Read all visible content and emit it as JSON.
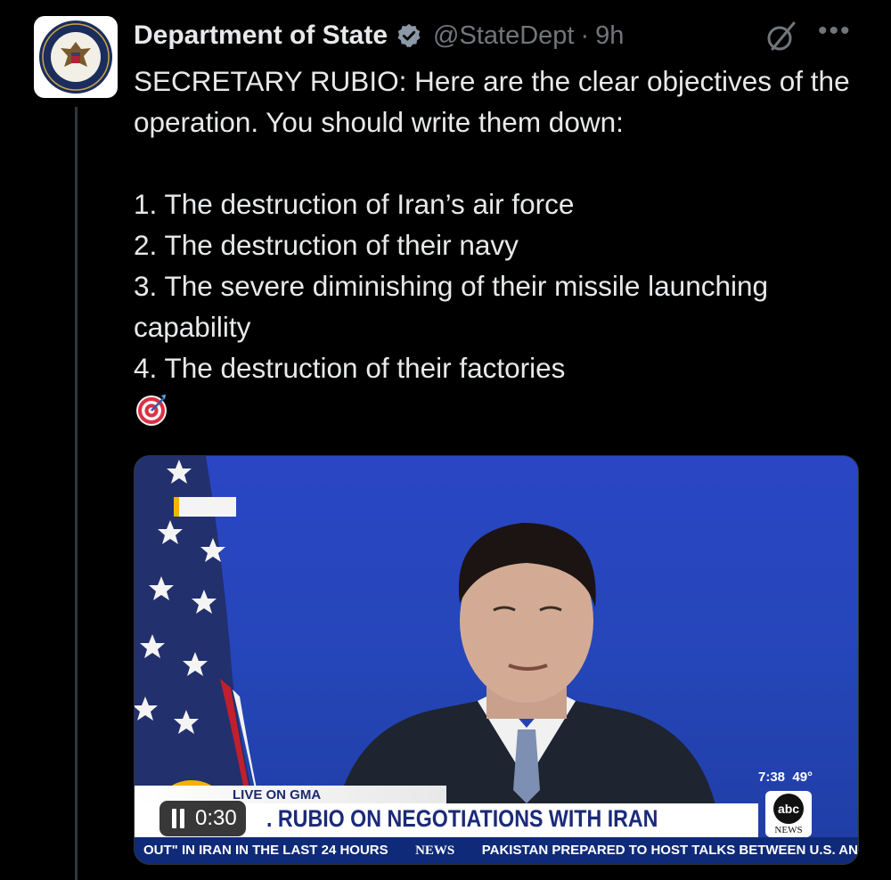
{
  "post": {
    "author_name": "Department of State",
    "handle": "@StateDept",
    "separator": "·",
    "time": "9h",
    "more_label": "•••",
    "body": {
      "intro": "SECRETARY RUBIO: Here are the clear objectives of the operation. You should write them down:",
      "items": [
        "1. The destruction of Iran’s air force",
        "2. The destruction of their navy",
        "3. The severe diminishing of their missile launching capability",
        "4. The destruction of their factories"
      ],
      "emoji": "direct-hit-icon"
    }
  },
  "video": {
    "elapsed": "0:30",
    "state": "playing",
    "overlay": {
      "clock": "7:38",
      "temperature": "49°",
      "network_logo_circle": "abc",
      "network_logo_word": "NEWS",
      "live_label": "LIVE ON GMA",
      "headline": ". RUBIO ON NEGOTIATIONS WITH IRAN",
      "ticker_1": "OUT\" IN IRAN IN THE LAST 24 HOURS",
      "ticker_logo": "NEWS",
      "ticker_2": "PAKISTAN PREPARED TO HOST TALKS BETWEEN U.S. AN"
    }
  },
  "colors": {
    "background": "#000000",
    "text_primary": "#e7e9ea",
    "text_secondary": "#71767b",
    "verified_badge": "#8b98a5",
    "video_backdrop": "#2546b9"
  }
}
